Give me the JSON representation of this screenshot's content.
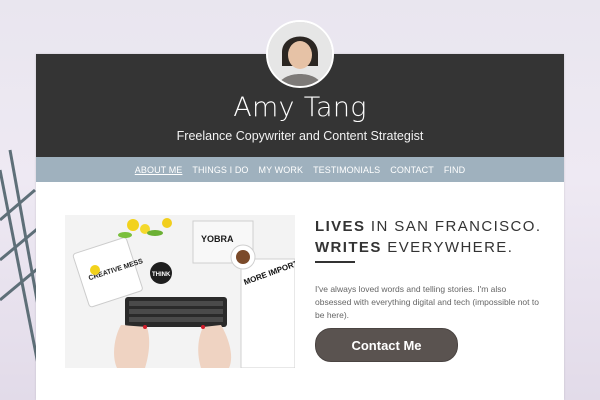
{
  "profile": {
    "name": "Amy Tang",
    "tagline": "Freelance Copywriter and Content Strategist"
  },
  "nav": {
    "items": [
      "ABOUT ME",
      "THINGS I DO",
      "MY WORK",
      "TESTIMONIALS",
      "CONTACT",
      "FIND"
    ],
    "active_index": 0
  },
  "intro": {
    "headline_line1_bold": "LIVES",
    "headline_line1_rest": " IN SAN FRANCISCO.",
    "headline_line2_bold": "WRITES",
    "headline_line2_rest": " EVERYWHERE.",
    "bio": "I've always loved words and telling stories. I'm also obsessed with everything digital and tech (impossible not to be here).",
    "cta_label": "Contact Me"
  },
  "hero_image": {
    "icon": "workspace-photo",
    "print_texts": [
      "YOBRA",
      "CREATIVE MESS",
      "THINK",
      "MORE IMPORTANT THAN"
    ]
  },
  "colors": {
    "header_bg": "#343434",
    "nav_bg": "#9fb1be",
    "cta_bg": "#5a5350",
    "page_bg": "#e9e6ef"
  }
}
